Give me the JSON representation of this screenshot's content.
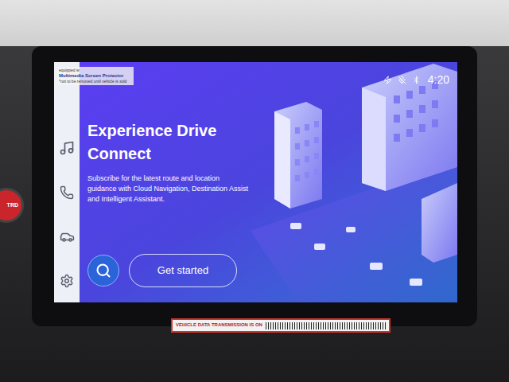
{
  "screen_sticker": {
    "lines": [
      "equipped w",
      "Multimedia Screen Protector",
      "*not to be removed until vehicle is sold"
    ]
  },
  "status_bar": {
    "time": "4:20"
  },
  "hero": {
    "title": "Experience Drive Connect",
    "subtitle": "Subscribe for the latest route and location guidance with Cloud Navigation, Destination Assist and Intelligent Assistant.",
    "button": "Get started"
  },
  "start_button": {
    "label": "TRD"
  },
  "dash_sticker": {
    "text": "VEHICLE DATA TRANSMISSION IS ON"
  }
}
